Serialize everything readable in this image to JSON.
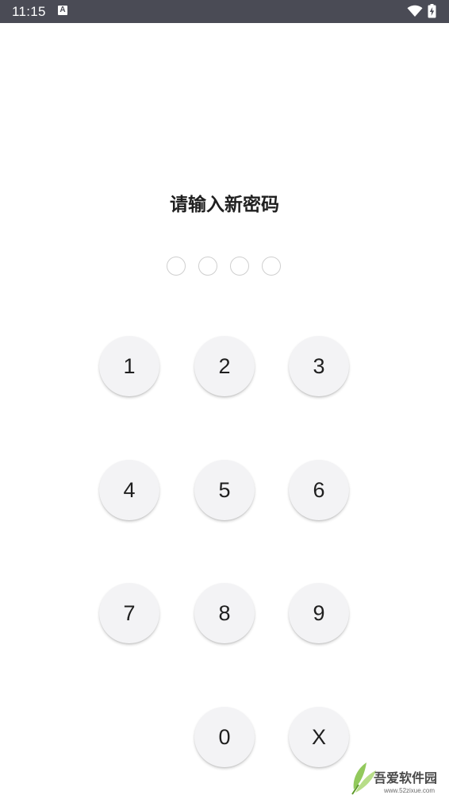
{
  "status_bar": {
    "time": "11:15",
    "notification_letter": "A",
    "icons": [
      "notification-a-icon",
      "wifi-icon",
      "battery-charging-icon"
    ],
    "background_color": "#4a4b55"
  },
  "title": "请输入新密码",
  "pin": {
    "length": 4,
    "filled": 0
  },
  "keypad": {
    "keys": [
      "1",
      "2",
      "3",
      "4",
      "5",
      "6",
      "7",
      "8",
      "9",
      "0",
      "X"
    ],
    "key_background": "#f3f3f5"
  },
  "watermark": {
    "text": "吾爱软件园",
    "url": "www.52zixue.com"
  }
}
